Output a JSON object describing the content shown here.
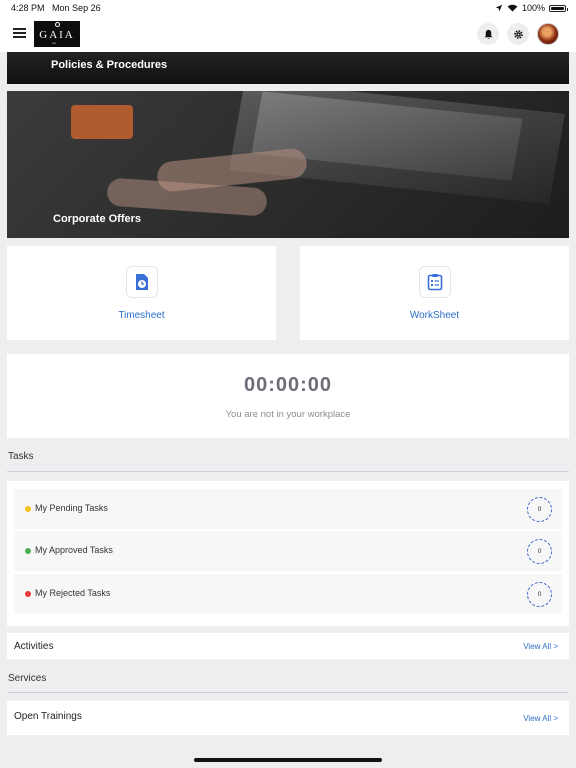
{
  "status_bar": {
    "time": "4:28 PM",
    "date": "Mon Sep 26",
    "battery": "100%"
  },
  "header": {
    "logo_text": "GAIA",
    "logo_mark": "~"
  },
  "banners": {
    "policies": "Policies & Procedures",
    "offers": "Corporate Offers"
  },
  "tiles": [
    {
      "label": "Timesheet",
      "icon": "timesheet-icon"
    },
    {
      "label": "WorkSheet",
      "icon": "worksheet-icon"
    }
  ],
  "timer": {
    "value": "00:00:00",
    "status": "You are not in your workplace"
  },
  "tasks": {
    "title": "Tasks",
    "items": [
      {
        "label": "My Pending Tasks",
        "count": "0",
        "color": "#f5c21b"
      },
      {
        "label": "My Approved Tasks",
        "count": "0",
        "color": "#4caf50"
      },
      {
        "label": "My Rejected Tasks",
        "count": "0",
        "color": "#e53935"
      }
    ]
  },
  "activities": {
    "title": "Activities",
    "view_all": "View All >"
  },
  "services": {
    "title": "Services",
    "item": "Open Trainings",
    "view_all": "View All >"
  },
  "colors": {
    "accent": "#2c6fc9",
    "background": "#eeeef1"
  }
}
